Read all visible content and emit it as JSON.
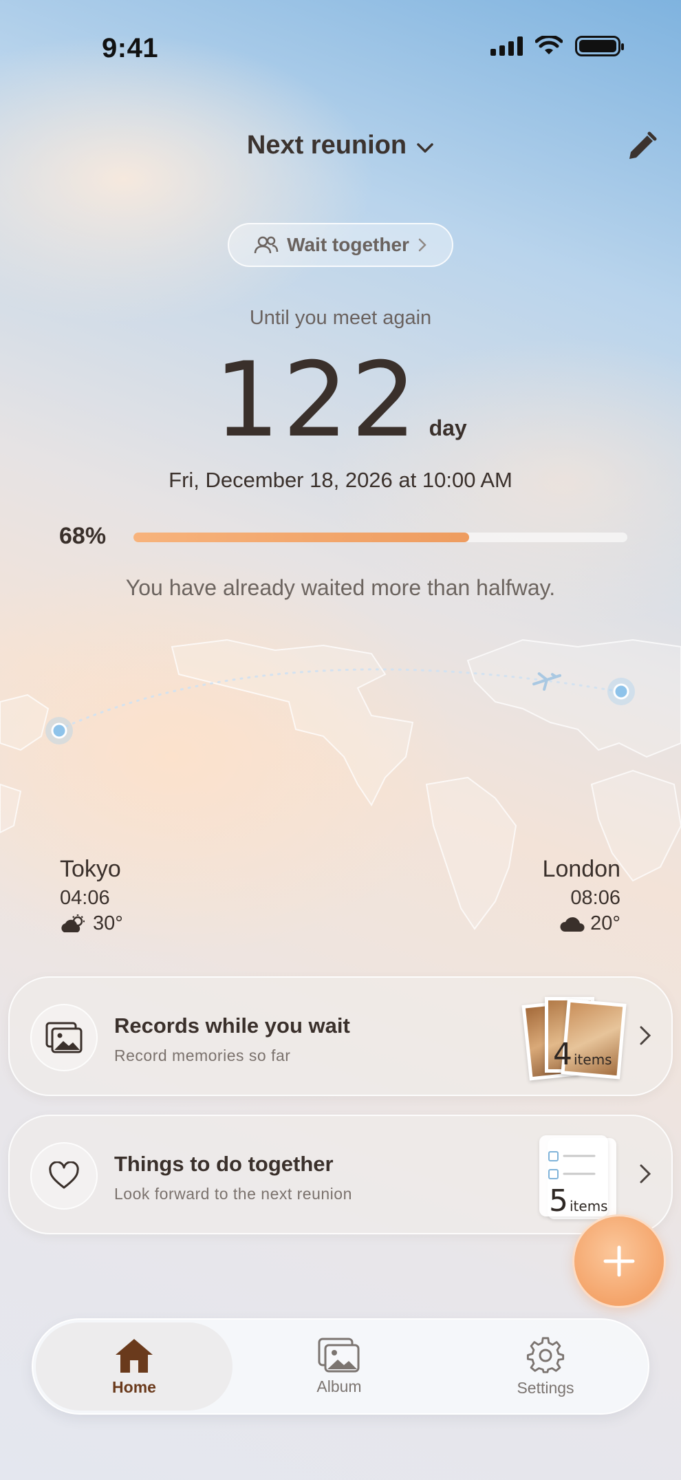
{
  "status_bar": {
    "time": "9:41"
  },
  "header": {
    "title": "Next reunion"
  },
  "wait_together": {
    "label": "Wait together"
  },
  "countdown": {
    "caption": "Until you meet again",
    "days": "122",
    "unit": "day",
    "target_date": "Fri, December 18, 2026 at 10:00 AM"
  },
  "progress": {
    "percent_label": "68%",
    "fraction": 0.68,
    "message": "You have already waited more than halfway."
  },
  "cities": {
    "left": {
      "name": "Tokyo",
      "time": "04:06",
      "temp": "30°",
      "weather_icon": "partly-sunny-icon"
    },
    "right": {
      "name": "London",
      "time": "08:06",
      "temp": "20°",
      "weather_icon": "cloud-icon"
    }
  },
  "cards": {
    "records": {
      "title": "Records while you wait",
      "subtitle": "Record memories so far",
      "count": "4",
      "count_unit": "items",
      "icon": "photos-icon"
    },
    "todo": {
      "title": "Things to do together",
      "subtitle": "Look forward to the next reunion",
      "count": "5",
      "count_unit": "items",
      "icon": "heart-icon"
    }
  },
  "tabs": [
    {
      "label": "Home",
      "icon": "home-icon",
      "active": true
    },
    {
      "label": "Album",
      "icon": "album-icon",
      "active": false
    },
    {
      "label": "Settings",
      "icon": "gear-icon",
      "active": false
    }
  ],
  "colors": {
    "accent": "#ee9c5f",
    "active_tab": "#6a3a1c",
    "text": "#3a302b"
  }
}
